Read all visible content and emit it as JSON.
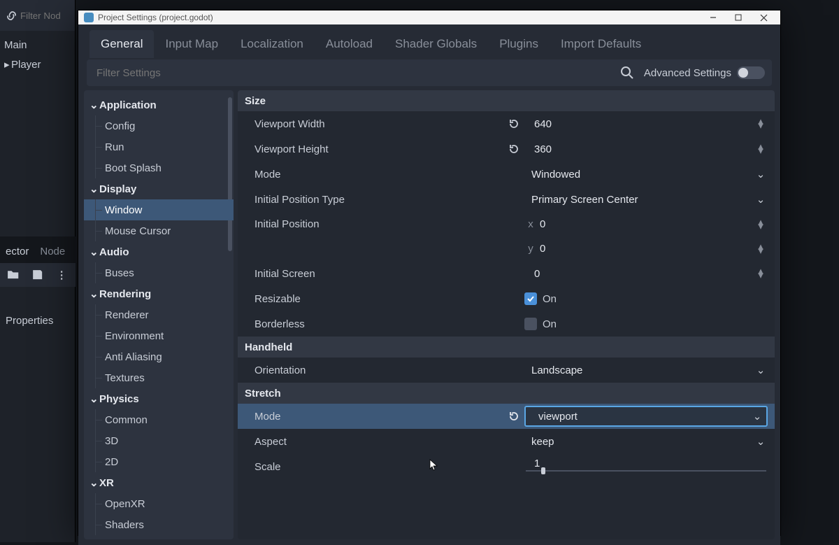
{
  "bg": {
    "filter_placeholder": "Filter Nod",
    "scene_main": "Main",
    "scene_player": "Player",
    "dock_tabs": {
      "inspector": "ector",
      "node": "Node"
    },
    "properties_label": "Properties"
  },
  "titlebar": {
    "title": "Project Settings (project.godot)"
  },
  "tabs": {
    "general": "General",
    "input_map": "Input Map",
    "localization": "Localization",
    "autoload": "Autoload",
    "shader_globals": "Shader Globals",
    "plugins": "Plugins",
    "import_defaults": "Import Defaults"
  },
  "search": {
    "placeholder": "Filter Settings",
    "advanced_label": "Advanced Settings"
  },
  "sidebar": {
    "categories": [
      {
        "name": "Application",
        "items": [
          "Config",
          "Run",
          "Boot Splash"
        ]
      },
      {
        "name": "Display",
        "items": [
          "Window",
          "Mouse Cursor"
        ],
        "selected_index": 0
      },
      {
        "name": "Audio",
        "items": [
          "Buses"
        ]
      },
      {
        "name": "Rendering",
        "items": [
          "Renderer",
          "Environment",
          "Anti Aliasing",
          "Textures"
        ]
      },
      {
        "name": "Physics",
        "items": [
          "Common",
          "3D",
          "2D"
        ]
      },
      {
        "name": "XR",
        "items": [
          "OpenXR",
          "Shaders"
        ]
      }
    ]
  },
  "sections": {
    "size": {
      "title": "Size",
      "viewport_width": {
        "label": "Viewport Width",
        "value": "640",
        "reset": true
      },
      "viewport_height": {
        "label": "Viewport Height",
        "value": "360",
        "reset": true
      },
      "mode": {
        "label": "Mode",
        "value": "Windowed"
      },
      "initial_pos_type": {
        "label": "Initial Position Type",
        "value": "Primary Screen Center"
      },
      "initial_position": {
        "label": "Initial Position",
        "x": "0",
        "y": "0"
      },
      "initial_screen": {
        "label": "Initial Screen",
        "value": "0"
      },
      "resizable": {
        "label": "Resizable",
        "value": "On",
        "checked": true
      },
      "borderless": {
        "label": "Borderless",
        "value": "On",
        "checked": false
      }
    },
    "handheld": {
      "title": "Handheld",
      "orientation": {
        "label": "Orientation",
        "value": "Landscape"
      }
    },
    "stretch": {
      "title": "Stretch",
      "mode": {
        "label": "Mode",
        "value": "viewport",
        "reset": true,
        "focused": true
      },
      "aspect": {
        "label": "Aspect",
        "value": "keep"
      },
      "scale": {
        "label": "Scale",
        "value": "1"
      }
    }
  }
}
